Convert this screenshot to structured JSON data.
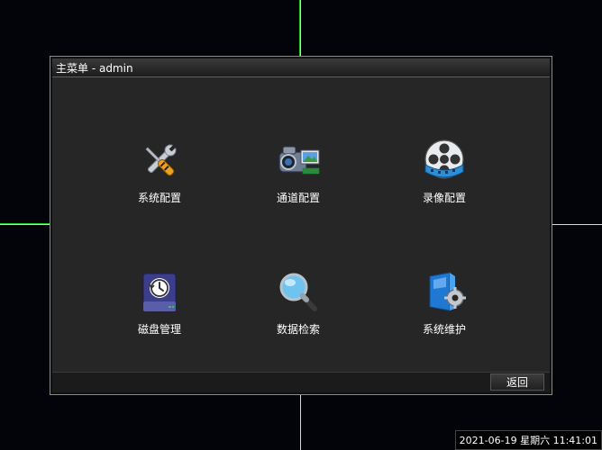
{
  "window": {
    "title": "主菜单 - admin"
  },
  "menu": {
    "items": [
      {
        "label": "系统配置",
        "icon": "tools-icon"
      },
      {
        "label": "通道配置",
        "icon": "camera-icon"
      },
      {
        "label": "录像配置",
        "icon": "film-reel-icon"
      },
      {
        "label": "磁盘管理",
        "icon": "hard-disk-icon"
      },
      {
        "label": "数据检索",
        "icon": "search-icon"
      },
      {
        "label": "系统维护",
        "icon": "maintenance-icon"
      }
    ]
  },
  "footer": {
    "back_label": "返回"
  },
  "status": {
    "datetime": "2021-06-19 星期六 11:41:01"
  },
  "colors": {
    "selection": "#1ecb2e",
    "title_accent": "#2b6fa0",
    "panel": "#262626"
  }
}
